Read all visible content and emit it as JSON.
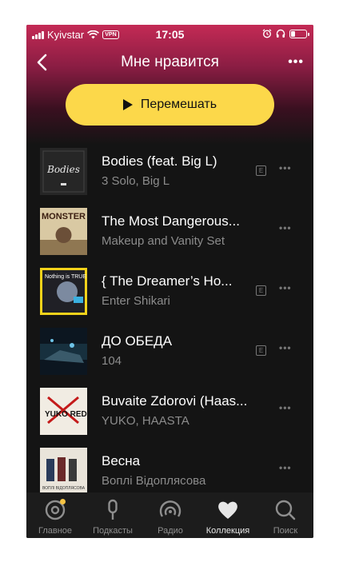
{
  "status_bar": {
    "carrier": "Kyivstar",
    "vpn": "VPN",
    "time": "17:05",
    "battery_level": 0.25
  },
  "header": {
    "title": "Мне нравится",
    "more": "•••"
  },
  "shuffle_button": {
    "label": "Перемешать"
  },
  "tracks": [
    {
      "title": "Bodies (feat. Big L)",
      "artist": "3 Solo, Big L",
      "explicit": true,
      "explicit_label": "E",
      "cover_text": "Bodies"
    },
    {
      "title": "The Most Dangerous...",
      "artist": "Makeup and Vanity Set",
      "explicit": false,
      "cover_text": "MONSTER"
    },
    {
      "title": "{ The Dreamer’s Ho...",
      "artist": "Enter Shikari",
      "explicit": true,
      "explicit_label": "E",
      "cover_text": "Nothing is TRUE"
    },
    {
      "title": "ДО ОБЕДА",
      "artist": "104",
      "explicit": true,
      "explicit_label": "E",
      "cover_text": ""
    },
    {
      "title": "Buvaite Zdorovi (Haas...",
      "artist": "YUKO, HAASTA",
      "explicit": false,
      "cover_text": "YUKO REDURA"
    },
    {
      "title": "Весна",
      "artist": "Воплі Відоплясова",
      "explicit": false,
      "cover_text": "ВОПЛІ ВІДОПЛЯСОВА"
    }
  ],
  "track_more": "•••",
  "tabs": [
    {
      "label": "Главное",
      "icon": "home-disc-icon",
      "active": false
    },
    {
      "label": "Подкасты",
      "icon": "microphone-icon",
      "active": false
    },
    {
      "label": "Радио",
      "icon": "radio-icon",
      "active": false
    },
    {
      "label": "Коллекция",
      "icon": "heart-icon",
      "active": true
    },
    {
      "label": "Поиск",
      "icon": "search-icon",
      "active": false
    }
  ],
  "colors": {
    "accent_yellow": "#fcd84a",
    "header_top": "#c42a55",
    "background": "#141414",
    "tab_dot": "#f6c344"
  }
}
